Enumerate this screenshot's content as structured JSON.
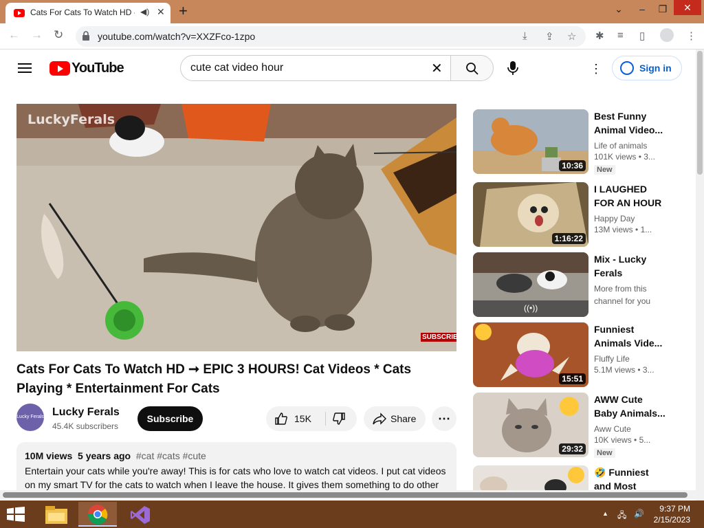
{
  "browser": {
    "tab_title": "Cats For Cats To Watch HD -",
    "url": "youtube.com/watch?v=XXZFco-1zpo"
  },
  "header": {
    "logo_text": "YouTube",
    "search_value": "cute cat video hour",
    "signin_label": "Sign in"
  },
  "player": {
    "watermark": "LuckyFerals",
    "subscribe_badge": "SUBSCRIBE"
  },
  "video": {
    "title": "Cats For Cats To Watch HD ➞ EPIC 3 HOURS! Cat Videos * Cats Playing * Entertainment For Cats",
    "channel": "Lucky Ferals",
    "subscribers": "45.4K subscribers",
    "avatar_text": "Lucky Ferals",
    "subscribe_label": "Subscribe",
    "likes": "15K",
    "share_label": "Share",
    "views": "10M views",
    "age": "5 years ago",
    "tags": "#cat #cats #cute",
    "description": "Entertain your cats while you're away! This is for cats who love to watch cat videos. I put cat videos on my smart TV for the cats to watch when I leave the house. It gives them something to do other"
  },
  "recommendations": [
    {
      "title": "Best Funny Animal Video...",
      "channel": "Life of animals",
      "views": "101K views",
      "age": "• 3...",
      "duration": "10:36",
      "badge": "New"
    },
    {
      "title": "I LAUGHED FOR AN HOUR😹...",
      "channel": "Happy Day",
      "views": "13M views",
      "age": "• 1...",
      "duration": "1:16:22",
      "badge": ""
    },
    {
      "title": "Mix - Lucky Ferals",
      "channel": "More from this channel for you",
      "views": "",
      "age": "",
      "duration": "",
      "badge": ""
    },
    {
      "title": "Funniest Animals Vide...",
      "channel": "Fluffy Life",
      "views": "5.1M views",
      "age": "• 3...",
      "duration": "15:51",
      "badge": ""
    },
    {
      "title": "AWW Cute Baby Animals...",
      "channel": "Aww Cute",
      "views": "10K views",
      "age": "• 5...",
      "duration": "29:32",
      "badge": "New"
    },
    {
      "title": "🤣 Funniest and Most Hilariou...",
      "channel": "",
      "views": "",
      "age": "",
      "duration": "",
      "badge": ""
    }
  ],
  "taskbar": {
    "time": "9:37 PM",
    "date": "2/15/2023"
  }
}
